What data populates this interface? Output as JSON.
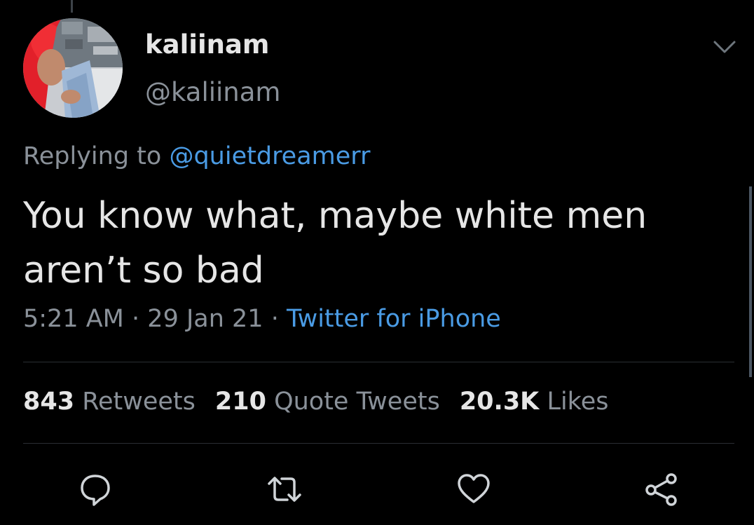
{
  "tweet": {
    "display_name": "kaliinam",
    "handle": "@kaliinam",
    "replying_prefix": "Replying to",
    "replying_to": "@quietdreamerr",
    "text_line1": "You know what, maybe white men",
    "text_line2": "aren’t so bad",
    "time": "5:21 AM",
    "date": "29 Jan 21",
    "separator": "·",
    "source": "Twitter for iPhone"
  },
  "stats": {
    "retweets_count": "843",
    "retweets_label": "Retweets",
    "quotes_count": "210",
    "quotes_label": "Quote Tweets",
    "likes_count": "20.3K",
    "likes_label": "Likes"
  },
  "icons": {
    "more": "chevron-down-icon",
    "reply": "reply-icon",
    "retweet": "retweet-icon",
    "like": "heart-icon",
    "share": "share-icon"
  },
  "colors": {
    "background": "#000000",
    "link": "#4a9be4",
    "secondary_text": "#8a9199",
    "primary_text": "#e6e6e6"
  }
}
